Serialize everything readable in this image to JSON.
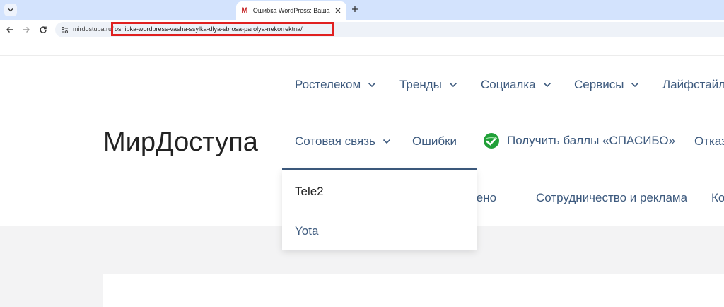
{
  "browser": {
    "tab": {
      "favicon_letter": "M",
      "title": "Ошибка WordPress: Ваша ссы"
    },
    "address": {
      "host": "mirdostupa.ru/",
      "path": "oshibka-wordpress-vasha-ssylka-dlya-sbrosa-parolya-nekorrektna/"
    }
  },
  "site": {
    "title": "МирДоступа",
    "nav_row1": [
      "Ростелеком",
      "Тренды",
      "Социалка",
      "Сервисы",
      "Лайфстайл"
    ],
    "nav_row2": [
      "Сотовая связь",
      "Ошибки",
      "Получить баллы «СПАСИБО»",
      "Отказ"
    ],
    "nav_row3": [
      "щено",
      "Сотрудничество и реклама",
      "Ко"
    ],
    "dropdown": [
      "Tele2",
      "Yota"
    ]
  },
  "colors": {
    "accent": "#3d5a7e",
    "highlight_box": "#e02020",
    "dropdown_item_active": "#3d5a7e",
    "dropdown_item": "#222222"
  }
}
